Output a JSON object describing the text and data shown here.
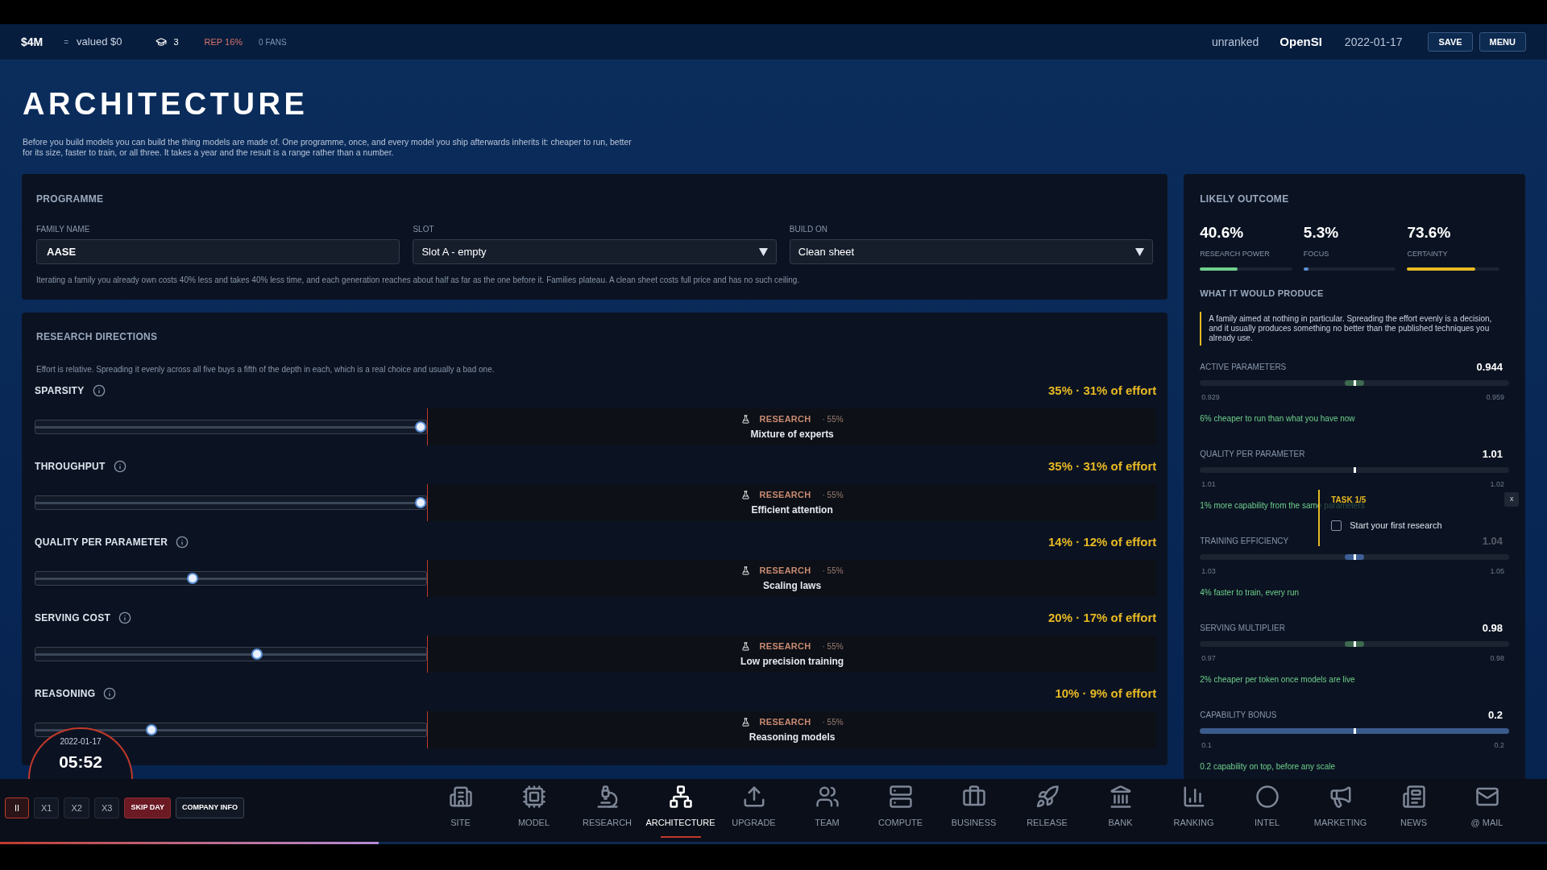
{
  "top_bar": {
    "cash": "$4M",
    "separator": "=",
    "valuation": "valued $0",
    "researchers": "3",
    "reputation": "REP 16%",
    "fans": "0 FANS",
    "rank": "unranked",
    "company": "OpenSI",
    "date": "2022-01-17",
    "buttons": [
      "SAVE",
      "MENU"
    ]
  },
  "page": {
    "title": "ARCHITECTURE",
    "description": "Before you build models you can build the thing models are made of. One programme, once, and every model you ship afterwards inherits it: cheaper to run, better for its size, faster to train, or all three. It takes a year and the result is a range rather than a number."
  },
  "programme": {
    "title": "PROGRAMME",
    "fields": [
      {
        "label": "FAMILY NAME",
        "kind": "text",
        "value": "AASE"
      },
      {
        "label": "SLOT",
        "kind": "select",
        "value": "Slot A - empty"
      },
      {
        "label": "BUILD ON",
        "kind": "select",
        "value": "Clean sheet"
      }
    ],
    "note": "Iterating a family you already own costs 40% less and takes 40% less time, and each generation reaches about half as far as the one before it. Families plateau. A clean sheet costs full price and has no such ceiling."
  },
  "research_directions": {
    "title": "RESEARCH DIRECTIONS",
    "note": "Effort is relative. Spreading it evenly across all five buys a fifth of the depth in each, which is a real choice and usually a bad one.",
    "directions": [
      {
        "name": "SPARSITY",
        "effort": "35% · 31% of effort",
        "level": 1,
        "research_label": "RESEARCH",
        "research_chance": "· 55%",
        "research_name": "Mixture of experts"
      },
      {
        "name": "THROUGHPUT",
        "effort": "35% · 31% of effort",
        "level": 1,
        "research_label": "RESEARCH",
        "research_chance": "· 55%",
        "research_name": "Efficient attention"
      },
      {
        "name": "QUALITY PER PARAMETER",
        "effort": "14% · 12% of effort",
        "level": 0.4,
        "research_label": "RESEARCH",
        "research_chance": "· 55%",
        "research_name": "Scaling laws"
      },
      {
        "name": "SERVING COST",
        "effort": "20% · 17% of effort",
        "level": 0.57,
        "research_label": "RESEARCH",
        "research_chance": "· 55%",
        "research_name": "Low precision training"
      },
      {
        "name": "REASONING",
        "effort": "10% · 9% of effort",
        "level": 0.29,
        "research_label": "RESEARCH",
        "research_chance": "· 55%",
        "research_name": "Reasoning models"
      }
    ]
  },
  "outcome": {
    "title": "LIKELY OUTCOME",
    "stats": [
      {
        "value": "40.6%",
        "label": "RESEARCH POWER",
        "level": 0.41,
        "color": "#6fd08c"
      },
      {
        "value": "5.3%",
        "label": "FOCUS",
        "level": 0.05,
        "color": "#5b8fd6"
      },
      {
        "value": "73.6%",
        "label": "CERTAINTY",
        "level": 0.74,
        "color": "#e8b923"
      }
    ],
    "produce_title": "WHAT IT WOULD PRODUCE",
    "summary": "A family aimed at nothing in particular. Spreading the effort evenly is a decision, and it usually produces something no better than the published techniques you already use.",
    "metrics": [
      {
        "name": "ACTIVE PARAMETERS",
        "value": "0.944",
        "min": "0.929",
        "max": "0.959",
        "effect": "6% cheaper to run than what you have now",
        "kind": "band",
        "color": "#3e6a4f",
        "level": 0.5
      },
      {
        "name": "QUALITY PER PARAMETER",
        "value": "1.01",
        "min": "1.01",
        "max": "1.02",
        "effect": "1% more capability from the same parameters",
        "kind": "none",
        "level": 0.5
      },
      {
        "name": "TRAINING EFFICIENCY",
        "value": "1.04",
        "min": "1.03",
        "max": "1.05",
        "effect": "4% faster to train, every run",
        "kind": "band",
        "color": "#3d5f96",
        "level": 0.5
      },
      {
        "name": "SERVING MULTIPLIER",
        "value": "0.98",
        "min": "0.97",
        "max": "0.98",
        "effect": "2% cheaper per token once models are live",
        "kind": "band",
        "color": "#3e6a4f",
        "level": 0.5
      },
      {
        "name": "CAPABILITY BONUS",
        "value": "0.2",
        "min": "0.1",
        "max": "0.2",
        "effect": "0.2 capability on top, before any scale",
        "kind": "full",
        "color": "#3b5b8c",
        "level": 0.5
      }
    ]
  },
  "task": {
    "title": "TASK 1/5",
    "close": "x",
    "item": {
      "label": "Start your first research",
      "checked": false
    }
  },
  "clock": {
    "date": "2022-01-17",
    "time": "05:52"
  },
  "speed_controls": [
    {
      "label": "II",
      "selected": true
    },
    {
      "label": "X1",
      "selected": false
    },
    {
      "label": "X2",
      "selected": false
    },
    {
      "label": "X3",
      "selected": false
    }
  ],
  "actions": [
    {
      "label": "SKIP DAY",
      "kind": "danger"
    },
    {
      "label": "COMPANY INFO",
      "kind": "plain"
    }
  ],
  "nav": [
    {
      "label": "SITE",
      "kind": "building",
      "selected": false
    },
    {
      "label": "MODEL",
      "kind": "chip",
      "selected": false
    },
    {
      "label": "RESEARCH",
      "kind": "microscope",
      "selected": false
    },
    {
      "label": "ARCHITECTURE",
      "kind": "network",
      "selected": true
    },
    {
      "label": "UPGRADE",
      "kind": "upload",
      "selected": false
    },
    {
      "label": "TEAM",
      "kind": "users",
      "selected": false
    },
    {
      "label": "COMPUTE",
      "kind": "server",
      "selected": false
    },
    {
      "label": "BUSINESS",
      "kind": "briefcase",
      "selected": false
    },
    {
      "label": "RELEASE",
      "kind": "rocket",
      "selected": false
    },
    {
      "label": "BANK",
      "kind": "bank",
      "selected": false
    },
    {
      "label": "RANKING",
      "kind": "chart",
      "selected": false
    },
    {
      "label": "INTEL",
      "kind": "circle",
      "selected": false
    },
    {
      "label": "MARKETING",
      "kind": "megaphone",
      "selected": false
    },
    {
      "label": "NEWS",
      "kind": "news",
      "selected": false
    },
    {
      "label": "@ MAIL",
      "kind": "mail",
      "selected": false
    }
  ],
  "day_progress": {
    "level": 0.245
  }
}
